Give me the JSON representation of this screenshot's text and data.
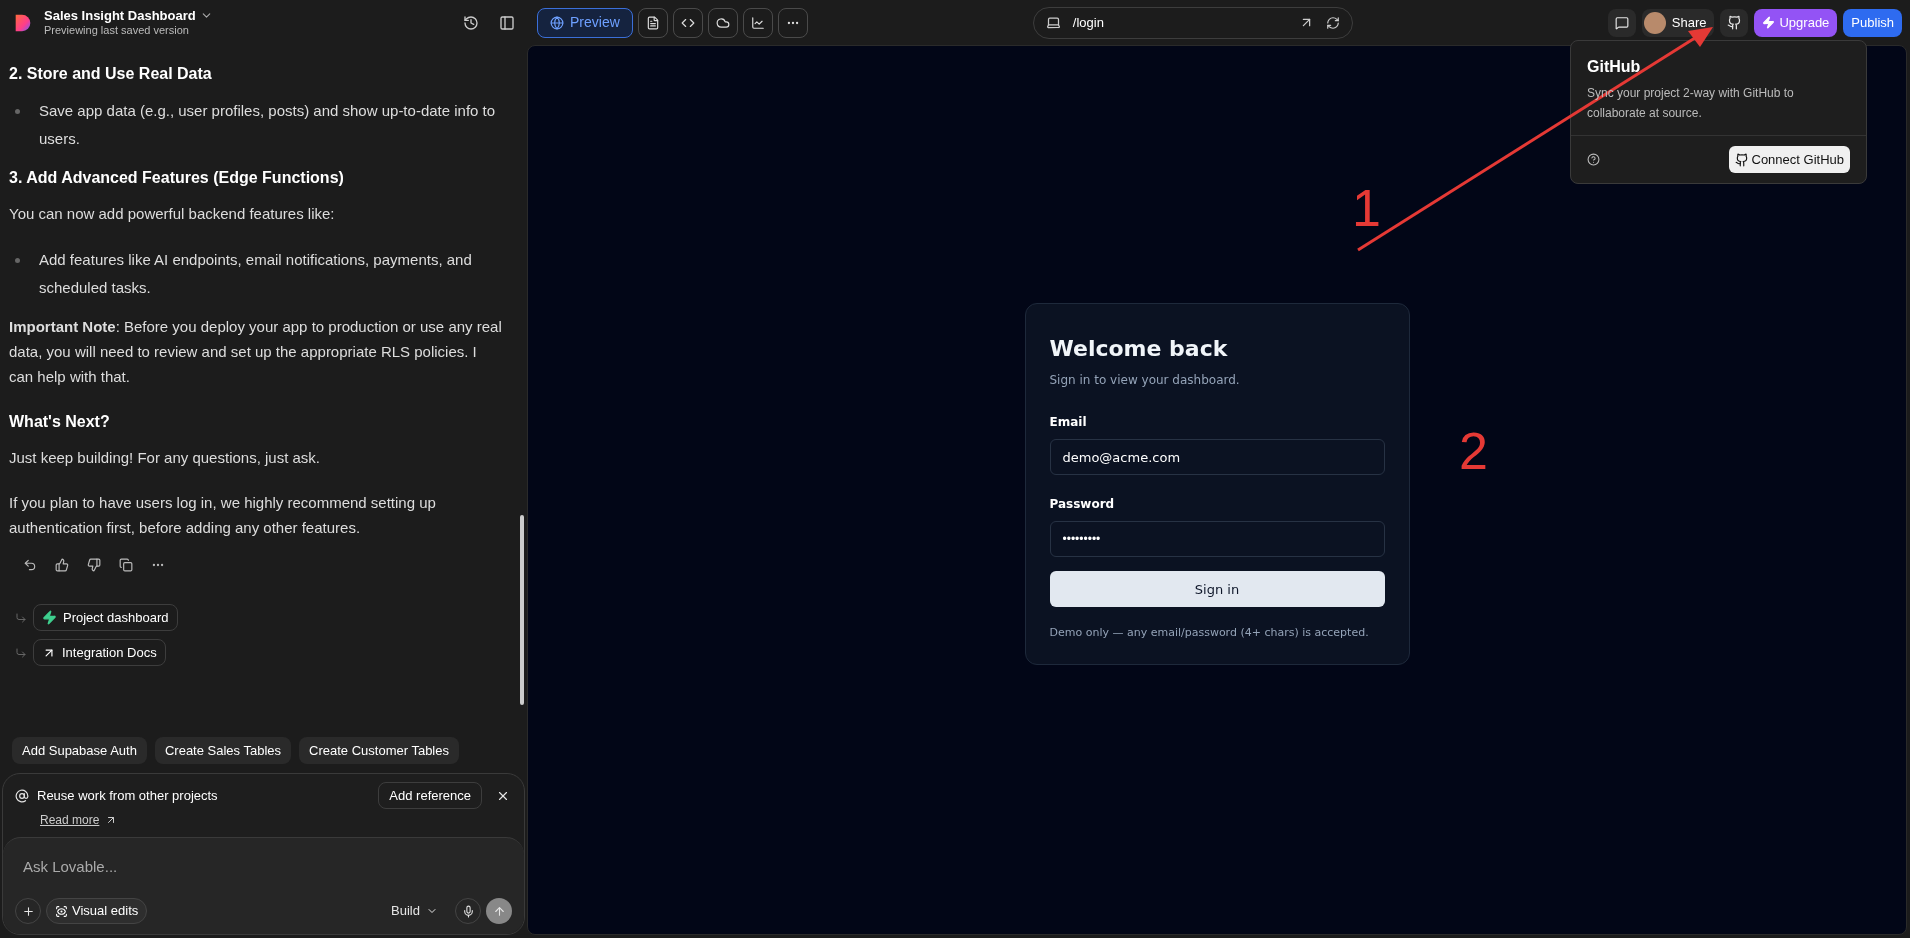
{
  "project": {
    "title": "Sales Insight Dashboard",
    "subtitle": "Previewing last saved version"
  },
  "toolbar": {
    "preview_label": "Preview",
    "preview_selected": true,
    "url": "/login"
  },
  "topbar_right": {
    "share": "Share",
    "upgrade": "Upgrade",
    "publish": "Publish"
  },
  "chat": {
    "blocks": [
      {
        "kind": "heading",
        "text": "2. Store and Use Real Data"
      },
      {
        "kind": "bullet",
        "text": "Save app data (e.g., user profiles, posts) and show up-to-date info to users."
      },
      {
        "kind": "heading",
        "text": "3. Add Advanced Features (Edge Functions)"
      },
      {
        "kind": "para",
        "text": "You can now add powerful backend features like:"
      },
      {
        "kind": "bullet",
        "text": "Add features like AI endpoints, email notifications, payments, and scheduled tasks."
      },
      {
        "kind": "para",
        "text": "**Important Note**: Before you deploy your app to production or use any real data, you will need to review and set up the appropriate RLS policies. I can help with that."
      },
      {
        "kind": "heading",
        "text": "What's Next?"
      },
      {
        "kind": "para",
        "text": "Just keep building! For any questions, just ask."
      },
      {
        "kind": "para",
        "text": "If you plan to have users log in, we highly recommend setting up authentication first, before adding any other features."
      }
    ],
    "action_links": [
      {
        "kind": "bolt",
        "label": "Project dashboard"
      },
      {
        "kind": "external",
        "label": "Integration Docs"
      }
    ]
  },
  "suggestions": [
    "Add Supabase Auth",
    "Create Sales Tables",
    "Create Customer Tables"
  ],
  "reference_tip": {
    "text": "Reuse work from other projects",
    "button": "Add reference",
    "link": "Read more"
  },
  "composer": {
    "placeholder": "Ask Lovable...",
    "visual_edits": "Visual edits",
    "mode": "Build"
  },
  "login": {
    "title": "Welcome back",
    "subtitle": "Sign in to view your dashboard.",
    "email_label": "Email",
    "email_value": "demo@acme.com",
    "password_label": "Password",
    "password_value": "•••••••••",
    "button": "Sign in",
    "note": "Demo only — any email/password (4+ chars) is accepted."
  },
  "github_popover": {
    "title": "GitHub",
    "description": "Sync your project 2-way with GitHub to collaborate at source.",
    "button": "Connect GitHub"
  },
  "annotations": [
    {
      "label": "1"
    },
    {
      "label": "2"
    }
  ]
}
